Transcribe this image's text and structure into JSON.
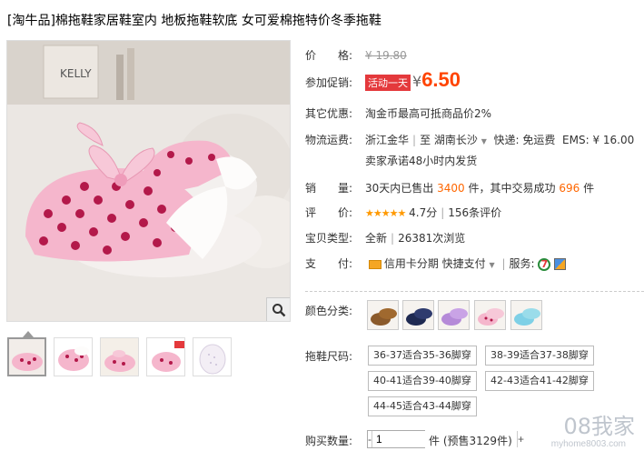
{
  "product": {
    "title": "[淘牛品]棉拖鞋家居鞋室内 地板拖鞋软底 女可爱棉拖特价冬季拖鞋"
  },
  "price": {
    "label": "价　　格:",
    "original": "¥ 19.80"
  },
  "promo": {
    "label": "参加促销:",
    "tag": "活动一天",
    "currency": "¥",
    "value": "6.50"
  },
  "offer": {
    "label": "其它优惠:",
    "text": "淘金币最高可抵商品价2%"
  },
  "shipping": {
    "label": "物流运费:",
    "from": "浙江金华",
    "to_prefix": "至",
    "to": "湖南长沙",
    "express": "快递: 免运费",
    "ems": "EMS: ¥ 16.00",
    "promise": "卖家承诺48小时内发货"
  },
  "sales": {
    "label": "销　　量:",
    "prefix": "30天内已售出",
    "sold": "3400",
    "mid": "件，其中交易成功",
    "success": "696",
    "suffix": "件"
  },
  "rating": {
    "label": "评　　价:",
    "stars": "★★★★★",
    "score": "4.7分",
    "reviews": "156条评价"
  },
  "type": {
    "label": "宝贝类型:",
    "value": "全新",
    "views": "26381次浏览"
  },
  "payment": {
    "label": "支　　付:",
    "credit": "信用卡分期",
    "quick": "快捷支付",
    "service_label": "服务:"
  },
  "colors": {
    "label": "颜色分类:",
    "options": [
      "brown",
      "navy",
      "purple",
      "pink",
      "blue"
    ]
  },
  "sizes": {
    "label": "拖鞋尺码:",
    "options": [
      "36-37适合35-36脚穿",
      "38-39适合37-38脚穿",
      "40-41适合39-40脚穿",
      "42-43适合41-42脚穿",
      "44-45适合43-44脚穿"
    ]
  },
  "quantity": {
    "label": "购买数量:",
    "value": "1",
    "unit": "件",
    "presale": "(预售3129件)"
  },
  "watermark": {
    "main": "08我家",
    "sub": "myhome8003.com"
  },
  "icons": {
    "zoom": "magnifier-icon",
    "credit": "credit-card-icon",
    "service7": "seven-day-return-icon",
    "service_flag": "guarantee-icon"
  },
  "theme": {
    "accent": "#f40",
    "tag": "#e4393c",
    "slipper_pink": "#f5b6cc",
    "dot": "#b3194a"
  }
}
